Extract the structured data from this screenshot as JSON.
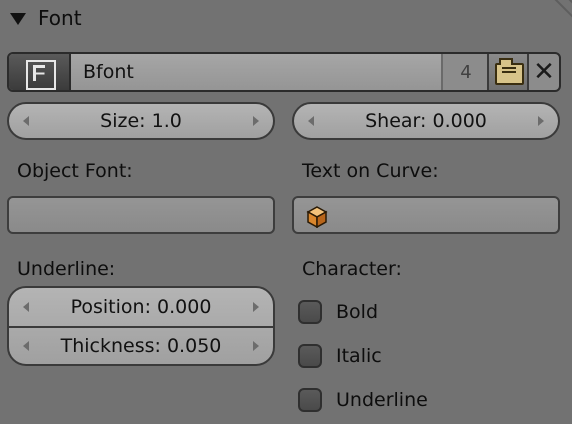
{
  "panel": {
    "title": "Font"
  },
  "font_block": {
    "name": "Bfont",
    "users": "4"
  },
  "sliders": {
    "size": "Size: 1.0",
    "shear": "Shear: 0.000"
  },
  "object_font": {
    "label": "Object Font:",
    "value": ""
  },
  "text_on_curve": {
    "label": "Text on Curve:",
    "value": ""
  },
  "underline": {
    "label": "Underline:",
    "position": "Position: 0.000",
    "thickness": "Thickness: 0.050"
  },
  "character": {
    "label": "Character:",
    "options": [
      {
        "label": "Bold",
        "checked": false
      },
      {
        "label": "Italic",
        "checked": false
      },
      {
        "label": "Underline",
        "checked": false
      }
    ]
  },
  "icons": {
    "font": "font-file-icon",
    "browse": "folder-open-icon",
    "unlink": "close-icon",
    "curve": "object-cube-icon",
    "collapse": "triangle-down-icon"
  }
}
